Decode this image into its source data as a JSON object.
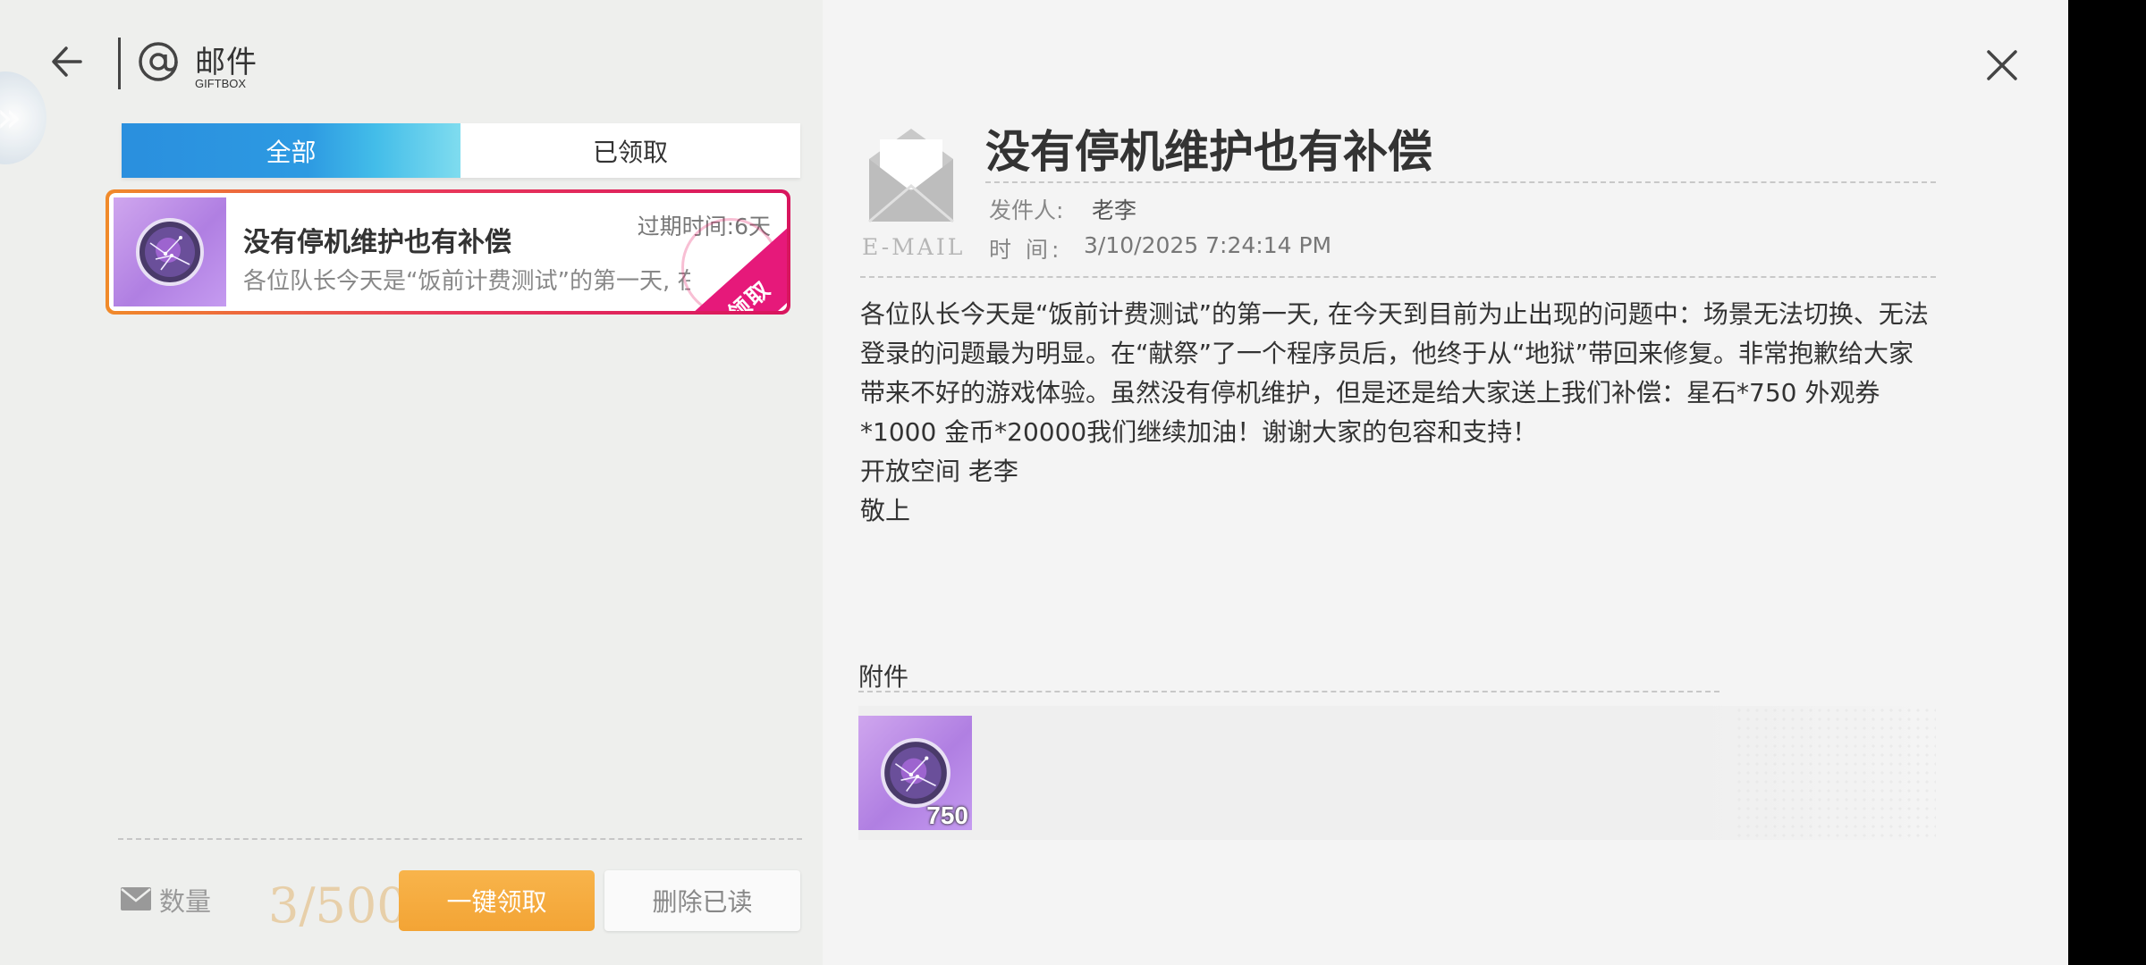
{
  "header": {
    "title": "邮件",
    "subtitle": "GIFTBOX"
  },
  "tabs": [
    {
      "label": "全部",
      "active": true
    },
    {
      "label": "已领取",
      "active": false
    }
  ],
  "mail_list": [
    {
      "title": "没有停机维护也有补偿",
      "expire": "过期时间:6天",
      "preview": "各位队长今天是“饭前计费测试”的第一天, 在今天到目前为止出现的问题中",
      "stamp": "已领取",
      "icon": "star-orb-icon"
    }
  ],
  "footer": {
    "count_label": "数量",
    "count_value": "3/500",
    "claim_all": "一键领取",
    "delete_read": "删除已读"
  },
  "detail": {
    "email_label": "E-MAIL",
    "title": "没有停机维护也有补偿",
    "sender_label": "发件人:",
    "sender": "老李",
    "time_label": "时 间:",
    "time": "3/10/2025 7:24:14 PM",
    "body_paragraph": "各位队长今天是“饭前计费测试”的第一天, 在今天到目前为止出现的问题中：场景无法切换、无法登录的问题最为明显。在“献祭”了一个程序员后，他终于从“地狱”带回来修复。非常抱歉给大家带来不好的游戏体验。虽然没有停机维护，但是还是给大家送上我们补偿：星石*750 外观券*1000 金币*20000我们继续加油！谢谢大家的包容和支持！",
    "signature": "开放空间 老李",
    "closing": "敬上",
    "attachments_label": "附件",
    "attachments": [
      {
        "icon": "star-orb-icon",
        "qty": "750"
      }
    ]
  },
  "colors": {
    "tab_active": "#2d9ae2",
    "claim_button": "#f5a93a",
    "stamp": "#e6197a",
    "left_bg": "#eeefed",
    "right_bg": "#f4f4f4"
  }
}
